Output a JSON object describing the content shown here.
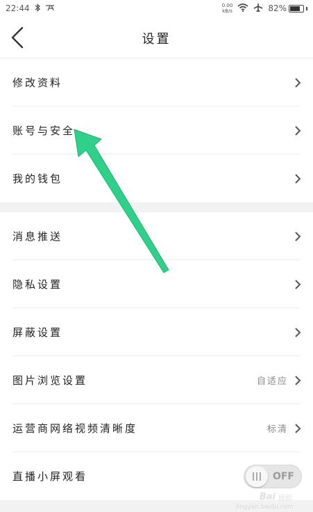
{
  "status_bar": {
    "time": "22:44",
    "net_speed_value": "0.00",
    "net_speed_unit": "kB/s",
    "battery_percent": "82%",
    "battery_level": 0.82
  },
  "nav": {
    "title": "设置"
  },
  "group1": [
    {
      "label": "修改资料"
    },
    {
      "label": "账号与安全"
    },
    {
      "label": "我的钱包"
    }
  ],
  "group2": [
    {
      "label": "消息推送"
    },
    {
      "label": "隐私设置"
    },
    {
      "label": "屏蔽设置"
    },
    {
      "label": "图片浏览设置",
      "value": "自适应"
    },
    {
      "label": "运营商网络视频清晰度",
      "value": "标清"
    },
    {
      "label": "直播小屏观看",
      "toggle": "OFF"
    }
  ],
  "watermark": {
    "brand": "Bai",
    "sub": "经验",
    "url": "jingyan.baidu.com"
  },
  "colors": {
    "annotation_arrow": "#2fd08a",
    "section_gap": "#f2f2f2"
  }
}
